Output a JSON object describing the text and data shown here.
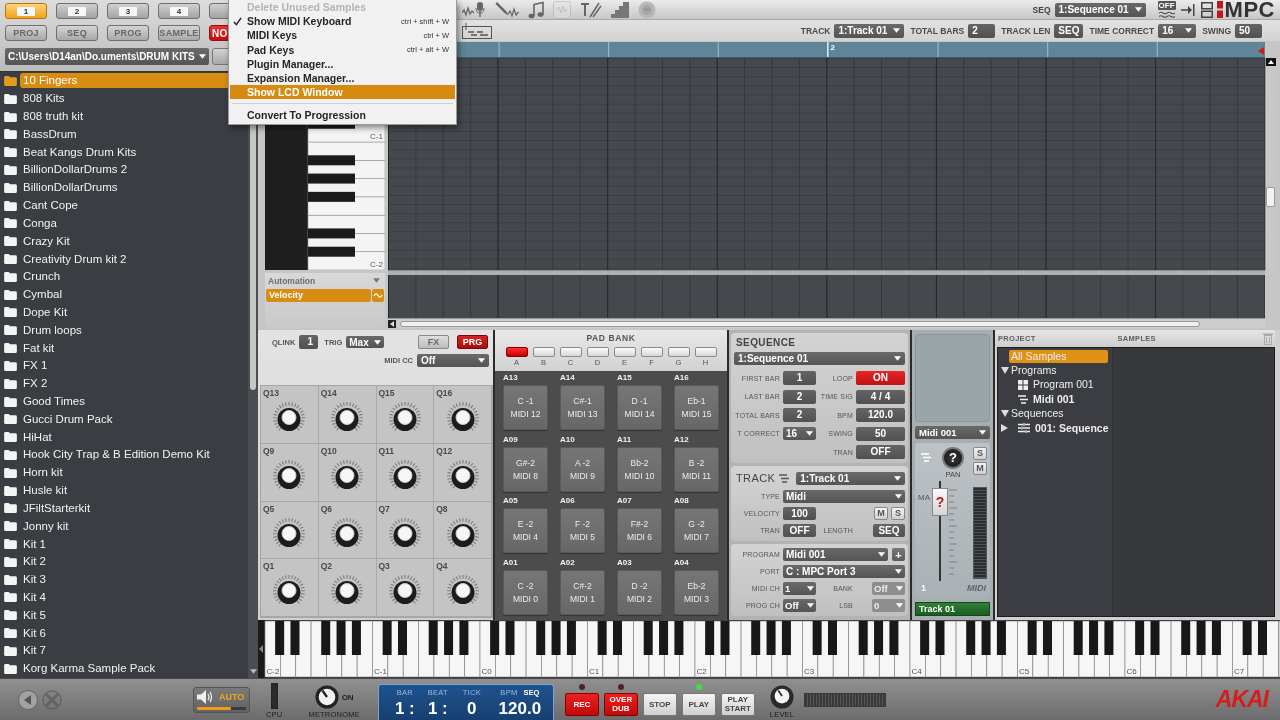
{
  "menu": {
    "items": [
      {
        "kind": "item",
        "label": "Delete Unused Samples",
        "disabled": true,
        "checked": false,
        "selected": false
      },
      {
        "kind": "item",
        "label": "Show MIDI Keyboard",
        "shortcut": "ctrl + shift + W",
        "disabled": false,
        "checked": true,
        "selected": false
      },
      {
        "kind": "item",
        "label": "MIDI Keys",
        "shortcut": "ctrl + W",
        "disabled": false,
        "checked": false,
        "selected": false
      },
      {
        "kind": "item",
        "label": "Pad Keys",
        "shortcut": "ctrl + alt + W",
        "disabled": false,
        "checked": false,
        "selected": false
      },
      {
        "kind": "item",
        "label": "Plugin Manager...",
        "disabled": false,
        "checked": false,
        "selected": false
      },
      {
        "kind": "item",
        "label": "Expansion Manager...",
        "disabled": false,
        "checked": false,
        "selected": false
      },
      {
        "kind": "item",
        "label": "Show LCD Window",
        "disabled": false,
        "checked": false,
        "selected": true
      },
      {
        "kind": "separator"
      },
      {
        "kind": "item",
        "label": "Convert To Progression",
        "disabled": false,
        "checked": false,
        "selected": false
      }
    ]
  },
  "browser": {
    "slot_tabs": [
      {
        "label": "1",
        "selected": true
      },
      {
        "label": "2",
        "selected": false
      },
      {
        "label": "3",
        "selected": false
      },
      {
        "label": "4",
        "selected": false
      },
      {
        "selected": false
      }
    ],
    "mode_buttons": [
      {
        "label": "PROJ",
        "kind": "mode"
      },
      {
        "label": "SEQ",
        "kind": "mode"
      },
      {
        "label": "PROG",
        "kind": "mode"
      },
      {
        "label": "SAMPLE",
        "kind": "mode"
      },
      {
        "label": "NO",
        "kind": "alert"
      }
    ],
    "path": "C:\\Users\\D14an\\Do.uments\\DRUM KITS",
    "folders": [
      {
        "name": "10 Fingers",
        "selected": true
      },
      {
        "name": "808 Kits",
        "selected": false
      },
      {
        "name": "808 truth kit",
        "selected": false
      },
      {
        "name": "BassDrum",
        "selected": false
      },
      {
        "name": "Beat Kangs Drum Kits",
        "selected": false
      },
      {
        "name": "BillionDollarDrums 2",
        "selected": false
      },
      {
        "name": "BillionDollarDrums",
        "selected": false
      },
      {
        "name": "Cant Cope",
        "selected": false
      },
      {
        "name": "Conga",
        "selected": false
      },
      {
        "name": "Crazy Kit",
        "selected": false
      },
      {
        "name": "Creativity Drum kit 2",
        "selected": false
      },
      {
        "name": "Crunch",
        "selected": false
      },
      {
        "name": "Cymbal",
        "selected": false
      },
      {
        "name": "Dope Kit",
        "selected": false
      },
      {
        "name": "Drum loops",
        "selected": false
      },
      {
        "name": "Fat kit",
        "selected": false
      },
      {
        "name": "FX 1",
        "selected": false
      },
      {
        "name": "FX 2",
        "selected": false
      },
      {
        "name": "Good Times",
        "selected": false
      },
      {
        "name": "Gucci Drum Pack",
        "selected": false
      },
      {
        "name": "HiHat",
        "selected": false
      },
      {
        "name": "Hook City Trap & B Edition Demo Kit",
        "selected": false
      },
      {
        "name": "Horn kit",
        "selected": false
      },
      {
        "name": "Husle kit",
        "selected": false
      },
      {
        "name": "JFiltStarterkit",
        "selected": false
      },
      {
        "name": "Jonny kit",
        "selected": false
      },
      {
        "name": "Kit 1",
        "selected": false
      },
      {
        "name": "Kit 2",
        "selected": false
      },
      {
        "name": "Kit 3",
        "selected": false
      },
      {
        "name": "Kit 4",
        "selected": false
      },
      {
        "name": "Kit 5",
        "selected": false
      },
      {
        "name": "Kit 6",
        "selected": false
      },
      {
        "name": "Kit 7",
        "selected": false
      },
      {
        "name": "Korg Karma Sample Pack",
        "selected": false
      }
    ]
  },
  "toolbar": {
    "tools": [
      {
        "kind": "record",
        "disabled": false
      },
      {
        "kind": "pencil",
        "disabled": false
      },
      {
        "kind": "note",
        "disabled": false
      },
      {
        "kind": "box",
        "disabled": true
      },
      {
        "kind": "text",
        "disabled": false
      },
      {
        "kind": "steps",
        "disabled": false
      },
      {
        "kind": "dot",
        "disabled": false
      }
    ],
    "seq_label": "SEQ",
    "sequence": "1:Sequence 01",
    "wave_badge": "OFF",
    "logo": "MPC"
  },
  "track_bar": {
    "fields": [
      {
        "label": "TRACK",
        "value": "1:Track 01",
        "kind": "dropdown"
      },
      {
        "label": "TOTAL BARS",
        "value": "2",
        "kind": "box"
      },
      {
        "label": "TRACK LEN",
        "value": "SEQ",
        "kind": "box"
      },
      {
        "label": "TIME CORRECT",
        "value": "16",
        "kind": "dropdown"
      },
      {
        "label": "SWING",
        "value": "50",
        "kind": "box"
      }
    ]
  },
  "ruler": {
    "bars": [
      {
        "kind": "bar"
      },
      {
        "kind": "bar",
        "label": "2"
      }
    ]
  },
  "piano_roll": {
    "key_labels": [
      "C-1",
      "C-2"
    ]
  },
  "automation": {
    "title": "Automation",
    "lanes": [
      {
        "name": "Velocity",
        "selected": true
      }
    ]
  },
  "qlink_panel": {
    "qlink_label": "QLINK",
    "qlink": "1",
    "trig_label": "TRIG",
    "trig": "Max",
    "mode_buttons": [
      {
        "label": "FX",
        "selected": false
      },
      {
        "label": "PRG",
        "selected": true
      }
    ],
    "midi_cc_label": "MIDI CC",
    "midi_cc": "Off",
    "knobs": [
      "Q13",
      "Q14",
      "Q15",
      "Q16",
      "Q9",
      "Q10",
      "Q11",
      "Q12",
      "Q5",
      "Q6",
      "Q7",
      "Q8",
      "Q1",
      "Q2",
      "Q3",
      "Q4"
    ]
  },
  "pad_bank": {
    "title": "PAD BANK",
    "banks": [
      {
        "label": "A",
        "selected": true
      },
      {
        "label": "B",
        "selected": false
      },
      {
        "label": "C",
        "selected": false
      },
      {
        "label": "D",
        "selected": false
      },
      {
        "label": "E",
        "selected": false
      },
      {
        "label": "F",
        "selected": false
      },
      {
        "label": "G",
        "selected": false
      },
      {
        "label": "H",
        "selected": false
      }
    ],
    "pads": [
      {
        "label": "A13",
        "note": "C -1",
        "midi": "MIDI 12"
      },
      {
        "label": "A14",
        "note": "C#-1",
        "midi": "MIDI 13"
      },
      {
        "label": "A15",
        "note": "D -1",
        "midi": "MIDI 14"
      },
      {
        "label": "A16",
        "note": "Eb-1",
        "midi": "MIDI 15"
      },
      {
        "label": "A09",
        "note": "G#-2",
        "midi": "MIDI 8"
      },
      {
        "label": "A10",
        "note": "A -2",
        "midi": "MIDI 9"
      },
      {
        "label": "A11",
        "note": "Bb-2",
        "midi": "MIDI 10"
      },
      {
        "label": "A12",
        "note": "B -2",
        "midi": "MIDI 11"
      },
      {
        "label": "A05",
        "note": "E -2",
        "midi": "MIDI 4"
      },
      {
        "label": "A06",
        "note": "F -2",
        "midi": "MIDI 5"
      },
      {
        "label": "A07",
        "note": "F#-2",
        "midi": "MIDI 6"
      },
      {
        "label": "A08",
        "note": "G -2",
        "midi": "MIDI 7"
      },
      {
        "label": "A01",
        "note": "C -2",
        "midi": "MIDI 0"
      },
      {
        "label": "A02",
        "note": "C#-2",
        "midi": "MIDI 1"
      },
      {
        "label": "A03",
        "note": "D -2",
        "midi": "MIDI 2"
      },
      {
        "label": "A04",
        "note": "Eb-2",
        "midi": "MIDI 3"
      }
    ]
  },
  "sequence_panel": {
    "title": "SEQUENCE",
    "sequence": "1:Sequence 01",
    "rows": [
      [
        {
          "label": "FIRST BAR",
          "value": "1",
          "kind": "box"
        },
        {
          "label": "LOOP",
          "value": "ON",
          "kind": "toggle",
          "on": true
        }
      ],
      [
        {
          "label": "LAST BAR",
          "value": "2",
          "kind": "box"
        },
        {
          "label": "TIME SIG",
          "value": "4 / 4",
          "kind": "box"
        }
      ],
      [
        {
          "label": "TOTAL BARS",
          "value": "2",
          "kind": "box"
        },
        {
          "label": "BPM",
          "value": "120.0",
          "kind": "box"
        }
      ],
      [
        {
          "label": "T CORRECT",
          "value": "16",
          "kind": "dropdown"
        },
        {
          "label": "SWING",
          "value": "50",
          "kind": "box"
        }
      ],
      [
        "",
        {
          "label": "TRAN",
          "value": "OFF",
          "kind": "toggle",
          "on": false
        }
      ]
    ]
  },
  "track_panel": {
    "title": "TRACK",
    "track": "1:Track 01",
    "type_label": "TYPE",
    "type": "Midi",
    "velocity_label": "VELOCITY",
    "velocity": "100",
    "mute": {
      "label": "M",
      "on": false
    },
    "solo": {
      "label": "S",
      "on": false
    },
    "tran_label": "TRAN",
    "tran": {
      "value": "OFF",
      "on": false
    },
    "length_label": "LENGTH",
    "length": "SEQ"
  },
  "program_panel": {
    "program_label": "PROGRAM",
    "program": "Midi 001",
    "add_button": "+",
    "port_label": "PORT",
    "port": "C : MPC Port 3",
    "midi_ch_label": "MIDI CH",
    "midi_ch": "1",
    "bank_label": "BANK",
    "bank": {
      "value": "Off",
      "disabled": true
    },
    "prog_ch_label": "PROG CH",
    "prog_ch": "Off",
    "lsb_label": "LSB",
    "lsb": {
      "value": "0",
      "disabled": true
    }
  },
  "mixer_strip": {
    "program": "Midi 001",
    "pan_value": "?",
    "pan_label": "PAN",
    "solo": {
      "label": "S",
      "on": false
    },
    "mute": {
      "label": "M",
      "on": false
    },
    "fader_label": "MA",
    "fader": {
      "value": "?",
      "level": 0.9
    },
    "channel": "1",
    "meter_label": "MIDI",
    "track": "Track 01"
  },
  "project_panel": {
    "headers": [
      "PROJECT",
      "SAMPLES"
    ],
    "tree": [
      {
        "label": "All Samples",
        "selected": true,
        "active": false
      },
      {
        "label": "Programs",
        "expanded": true,
        "selected": false,
        "active": false,
        "children": [
          {
            "label": "Program 001",
            "kind": "program",
            "selected": false,
            "active": false
          },
          {
            "label": "Midi 001",
            "kind": "midi",
            "selected": false,
            "active": true
          }
        ]
      },
      {
        "label": "Sequences",
        "expanded": true,
        "selected": false,
        "active": false,
        "children": [
          {
            "label": "001: Sequence",
            "kind": "sequence",
            "expanded": false,
            "selected": false,
            "active": true
          }
        ]
      }
    ]
  },
  "keyboard": {
    "octave_labels": [
      "C-2",
      "C-1",
      "C0",
      "C1",
      "C2",
      "C3",
      "C4",
      "C5",
      "C6",
      "C7"
    ]
  },
  "transport": {
    "auto_label": "AUTO",
    "volume": {
      "level": 0.7
    },
    "cpu_label": "CPU",
    "metronome_on": "ON",
    "metronome_label": "METRONOME",
    "lcd": {
      "cells": [
        {
          "label": "BAR",
          "value": "1 :"
        },
        {
          "label": "BEAT",
          "value": "1 :"
        },
        {
          "label": "TICK",
          "value": "0"
        },
        {
          "label": "BPM",
          "value": "120.0"
        }
      ],
      "mode": "SEQ"
    },
    "buttons": [
      {
        "label": "REC",
        "kind": "record",
        "lamp": false
      },
      {
        "label": "OVER DUB",
        "kind": "record",
        "lamp": false
      },
      {
        "label": "STOP",
        "kind": "plain"
      },
      {
        "label": "PLAY",
        "kind": "plain",
        "lamp": true
      },
      {
        "label": "PLAY START",
        "kind": "plain"
      }
    ],
    "level_label": "LEVEL",
    "logo": "AKAI"
  }
}
